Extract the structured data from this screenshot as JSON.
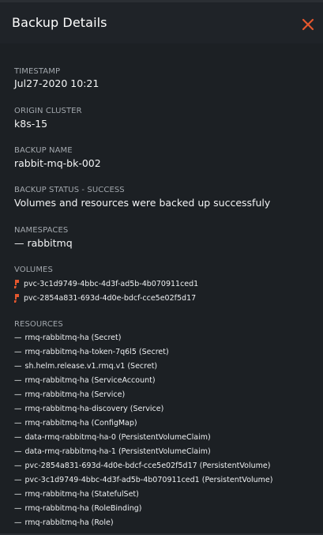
{
  "panel": {
    "title": "Backup Details"
  },
  "colors": {
    "background": "#1c2024",
    "header_background": "#1f2328",
    "label": "#a2a7ad",
    "text": "#f4f5f6",
    "accent": "#e4572e"
  },
  "icons": {
    "close": "close-icon",
    "volume": "volume-icon"
  },
  "details": {
    "timestamp_label": "TIMESTAMP",
    "timestamp_value": "Jul27-2020 10:21",
    "origin_cluster_label": "ORIGIN CLUSTER",
    "origin_cluster_value": "k8s-15",
    "backup_name_label": "BACKUP NAME",
    "backup_name_value": "rabbit-mq-bk-002",
    "backup_status_label": "BACKUP STATUS - SUCCESS",
    "backup_status_value": "Volumes and resources were backed up successfuly",
    "namespaces_label": "NAMESPACES",
    "namespaces": [
      "rabbitmq"
    ],
    "volumes_label": "VOLUMES",
    "volumes": [
      "pvc-3c1d9749-4bbc-4d3f-ad5b-4b070911ced1",
      "pvc-2854a831-693d-4d0e-bdcf-cce5e02f5d17"
    ],
    "resources_label": "RESOURCES",
    "resources": [
      "rmq-rabbitmq-ha (Secret)",
      "rmq-rabbitmq-ha-token-7q6l5 (Secret)",
      "sh.helm.release.v1.rmq.v1 (Secret)",
      "rmq-rabbitmq-ha (ServiceAccount)",
      "rmq-rabbitmq-ha (Service)",
      "rmq-rabbitmq-ha-discovery (Service)",
      "rmq-rabbitmq-ha (ConfigMap)",
      "data-rmq-rabbitmq-ha-0 (PersistentVolumeClaim)",
      "data-rmq-rabbitmq-ha-1 (PersistentVolumeClaim)",
      "pvc-2854a831-693d-4d0e-bdcf-cce5e02f5d17 (PersistentVolume)",
      "pvc-3c1d9749-4bbc-4d3f-ad5b-4b070911ced1 (PersistentVolume)",
      "rmq-rabbitmq-ha (StatefulSet)",
      "rmq-rabbitmq-ha (RoleBinding)",
      "rmq-rabbitmq-ha (Role)"
    ]
  }
}
